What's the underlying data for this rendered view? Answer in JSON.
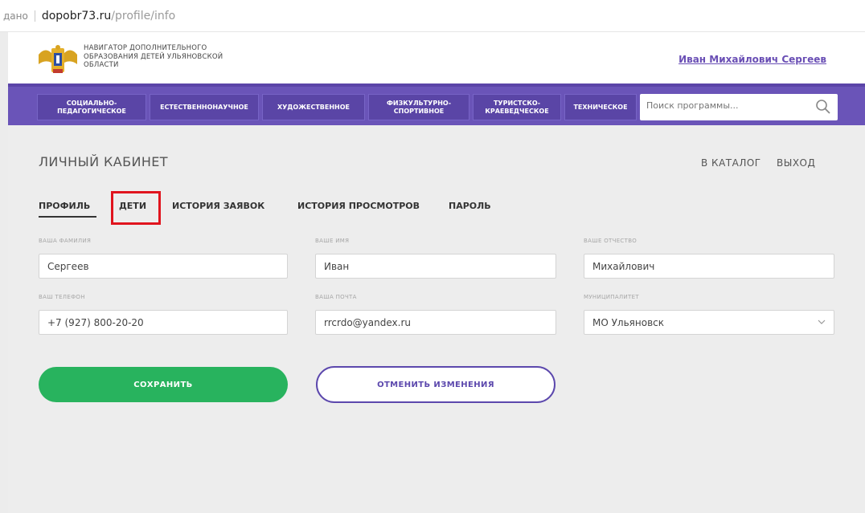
{
  "address_bar": {
    "prefix": "дано",
    "domain": "dopobr73.ru",
    "path": "/profile/info"
  },
  "header": {
    "brand_line1": "Навигатор дополнительного",
    "brand_line2": "образования детей Ульяновской",
    "brand_line3": "области",
    "user_name": "Иван Михайлович Сергеев"
  },
  "nav": {
    "items": [
      {
        "label": "Социально-педагогическое"
      },
      {
        "label": "Естественнонаучное"
      },
      {
        "label": "Художественное"
      },
      {
        "label": "Физкультурно-спортивное"
      },
      {
        "label": "Туристско-краеведческое"
      },
      {
        "label": "Техническое"
      }
    ],
    "search_placeholder": "Поиск программы..."
  },
  "page": {
    "title": "ЛИЧНЫЙ КАБИНЕТ",
    "catalog_link": "В КАТАЛОГ",
    "logout_link": "ВЫХОД"
  },
  "tabs": [
    {
      "label": "ПРОФИЛЬ",
      "active": true
    },
    {
      "label": "ДЕТИ"
    },
    {
      "label": "ИСТОРИЯ ЗАЯВОК"
    },
    {
      "label": "ИСТОРИЯ ПРОСМОТРОВ"
    },
    {
      "label": "ПАРОЛЬ"
    }
  ],
  "form": {
    "surname": {
      "label": "Ваша фамилия",
      "value": "Сергеев"
    },
    "name": {
      "label": "Ваше имя",
      "value": "Иван"
    },
    "patronymic": {
      "label": "Ваше отчество",
      "value": "Михайлович"
    },
    "phone": {
      "label": "Ваш телефон",
      "value": "+7 (927) 800-20-20"
    },
    "email": {
      "label": "Ваша почта",
      "value": "rrcrdo@yandex.ru"
    },
    "municipality": {
      "label": "Муниципалитет",
      "value": "МО Ульяновск"
    }
  },
  "buttons": {
    "save": "СОХРАНИТЬ",
    "cancel": "ОТМЕНИТЬ ИЗМЕНЕНИЯ"
  },
  "colors": {
    "nav": "#6a54b8",
    "save": "#28b35e",
    "accent": "#5c48ad",
    "highlight": "#e0141e"
  }
}
